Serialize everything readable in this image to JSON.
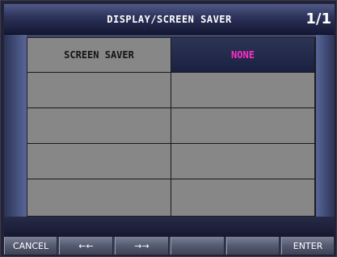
{
  "header": {
    "title": "DISPLAY/SCREEN SAVER",
    "page_indicator": "1/1"
  },
  "table": {
    "rows": [
      {
        "label": "SCREEN SAVER",
        "value": "NONE",
        "selected": true
      },
      {
        "label": "",
        "value": ""
      },
      {
        "label": "",
        "value": ""
      },
      {
        "label": "",
        "value": ""
      },
      {
        "label": "",
        "value": ""
      }
    ]
  },
  "buttons": [
    {
      "label": "CANCEL"
    },
    {
      "label": "←←"
    },
    {
      "label": "→→"
    },
    {
      "label": ""
    },
    {
      "label": ""
    },
    {
      "label": "ENTER"
    }
  ],
  "colors": {
    "selected_value_text": "#ff2ec8",
    "title_text": "#ffffff"
  }
}
